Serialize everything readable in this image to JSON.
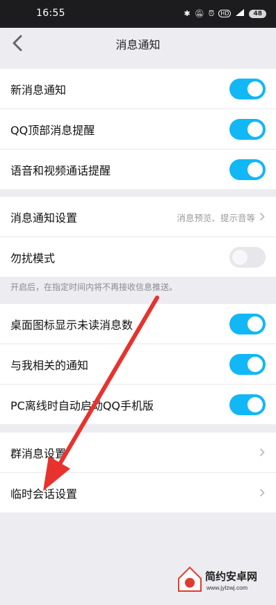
{
  "status_bar": {
    "time": "16:55",
    "indicator_text": "HD",
    "battery": "48"
  },
  "header": {
    "title": "消息通知"
  },
  "group1": [
    {
      "label": "新消息通知",
      "on": true
    },
    {
      "label": "QQ顶部消息提醒",
      "on": true
    },
    {
      "label": "语音和视频通话提醒",
      "on": true
    }
  ],
  "group2": {
    "notification_settings": {
      "label": "消息通知设置",
      "detail": "消息预览、提示音等"
    },
    "dnd": {
      "label": "勿扰模式",
      "on": false
    }
  },
  "hint": "开启后，在指定时间内将不再接收信息推送。",
  "group3": [
    {
      "label": "桌面图标显示未读消息数",
      "on": true
    },
    {
      "label": "与我相关的通知",
      "on": true
    },
    {
      "label": "PC离线时自动启动QQ手机版",
      "on": true
    }
  ],
  "group4": {
    "group_msg": {
      "label": "群消息设置"
    },
    "temp_chat": {
      "label": "临时会话设置"
    }
  },
  "watermark": {
    "brand": "简约安卓网",
    "url": "www.jylzwj.com"
  },
  "colors": {
    "toggle_on": "#12b7f5",
    "annotation_arrow": "#e8322d",
    "background": "#ececf1"
  }
}
